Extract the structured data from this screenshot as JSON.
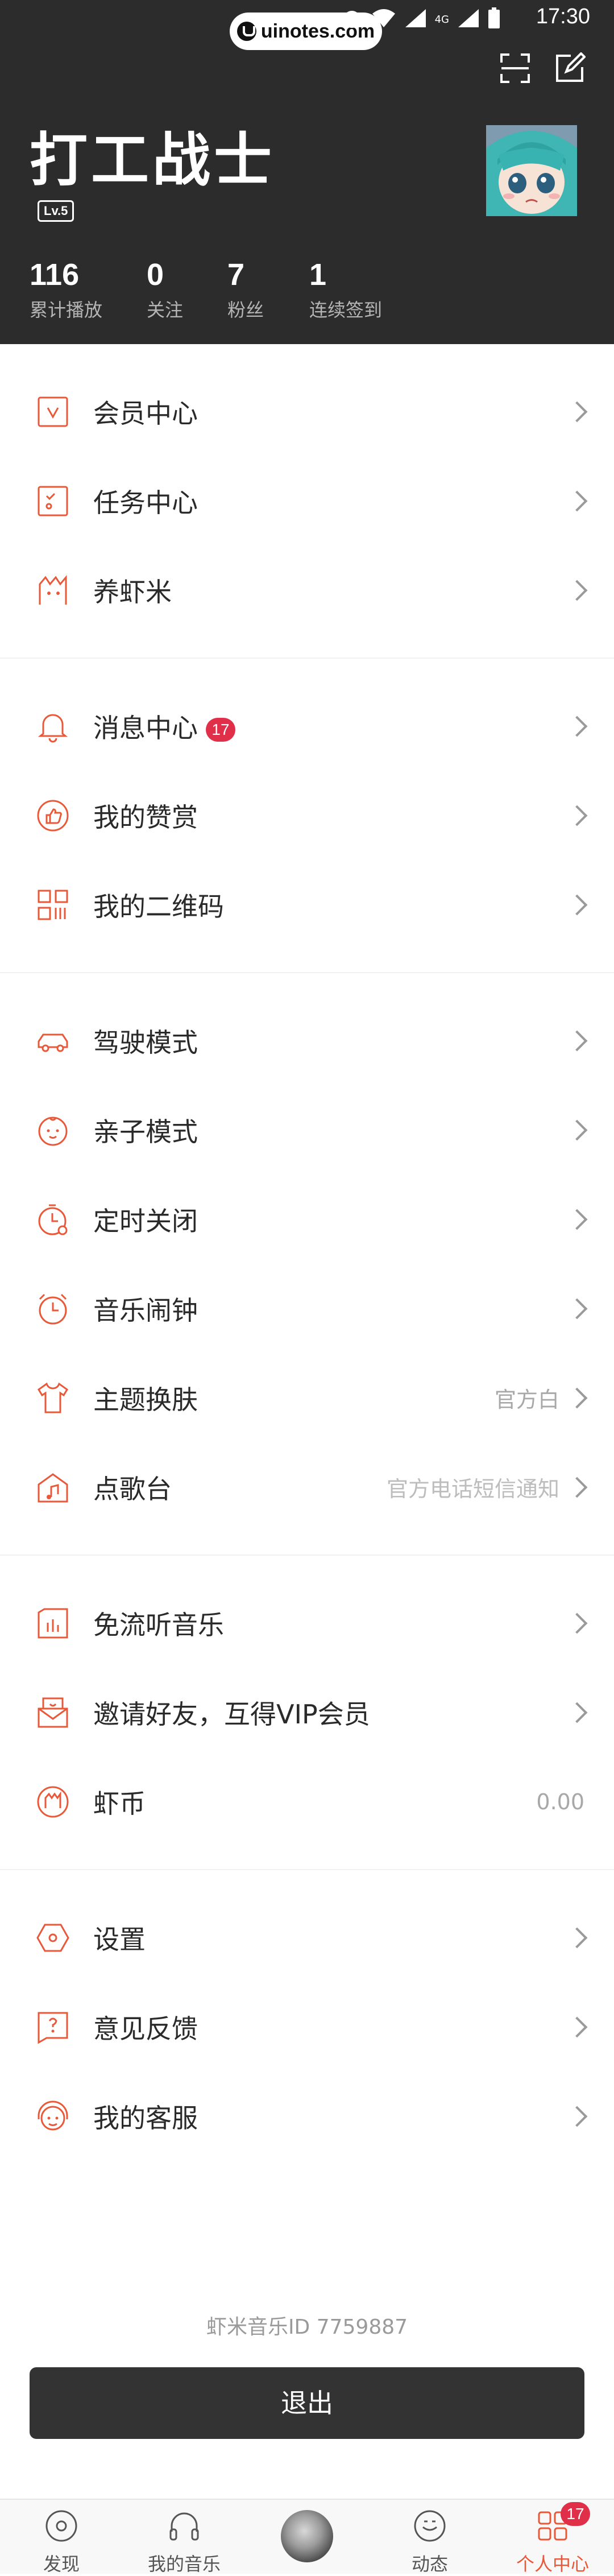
{
  "status_bar": {
    "time": "17:30",
    "network": "4G",
    "watermark": "uinotes.com"
  },
  "profile": {
    "username": "打工战士",
    "level": "Lv.5",
    "stats": [
      {
        "value": "116",
        "label": "累计播放"
      },
      {
        "value": "0",
        "label": "关注"
      },
      {
        "value": "7",
        "label": "粉丝"
      },
      {
        "value": "1",
        "label": "连续签到"
      }
    ]
  },
  "menu": {
    "groups": [
      {
        "items": [
          {
            "icon": "vip-icon",
            "label": "会员中心"
          },
          {
            "icon": "task-icon",
            "label": "任务中心"
          },
          {
            "icon": "shrimp-icon",
            "label": "养虾米"
          }
        ]
      },
      {
        "items": [
          {
            "icon": "bell-icon",
            "label": "消息中心",
            "badge": "17"
          },
          {
            "icon": "thumbs-up-icon",
            "label": "我的赞赏"
          },
          {
            "icon": "qr-code-icon",
            "label": "我的二维码"
          }
        ]
      },
      {
        "items": [
          {
            "icon": "car-icon",
            "label": "驾驶模式"
          },
          {
            "icon": "baby-icon",
            "label": "亲子模式"
          },
          {
            "icon": "timer-icon",
            "label": "定时关闭"
          },
          {
            "icon": "alarm-icon",
            "label": "音乐闹钟"
          },
          {
            "icon": "tshirt-icon",
            "label": "主题换肤",
            "value": "官方白"
          },
          {
            "icon": "music-box-icon",
            "label": "点歌台",
            "value": "官方电话短信通知"
          }
        ]
      },
      {
        "items": [
          {
            "icon": "free-music-icon",
            "label": "免流听音乐"
          },
          {
            "icon": "invite-icon",
            "label": "邀请好友，互得VIP会员"
          },
          {
            "icon": "coin-icon",
            "label": "虾币",
            "value": "0.00"
          }
        ]
      },
      {
        "items": [
          {
            "icon": "settings-icon",
            "label": "设置"
          },
          {
            "icon": "feedback-icon",
            "label": "意见反馈"
          },
          {
            "icon": "service-icon",
            "label": "我的客服"
          }
        ]
      }
    ]
  },
  "footer": {
    "user_id": "虾米音乐ID 7759887",
    "logout": "退出"
  },
  "tabs": [
    {
      "label": "发现"
    },
    {
      "label": "我的音乐"
    },
    {
      "label": ""
    },
    {
      "label": "动态"
    },
    {
      "label": "个人中心",
      "badge": "17"
    }
  ],
  "colors": {
    "accent": "#e8593a",
    "header_bg": "#2c2c2c",
    "badge": "#e02f49"
  }
}
